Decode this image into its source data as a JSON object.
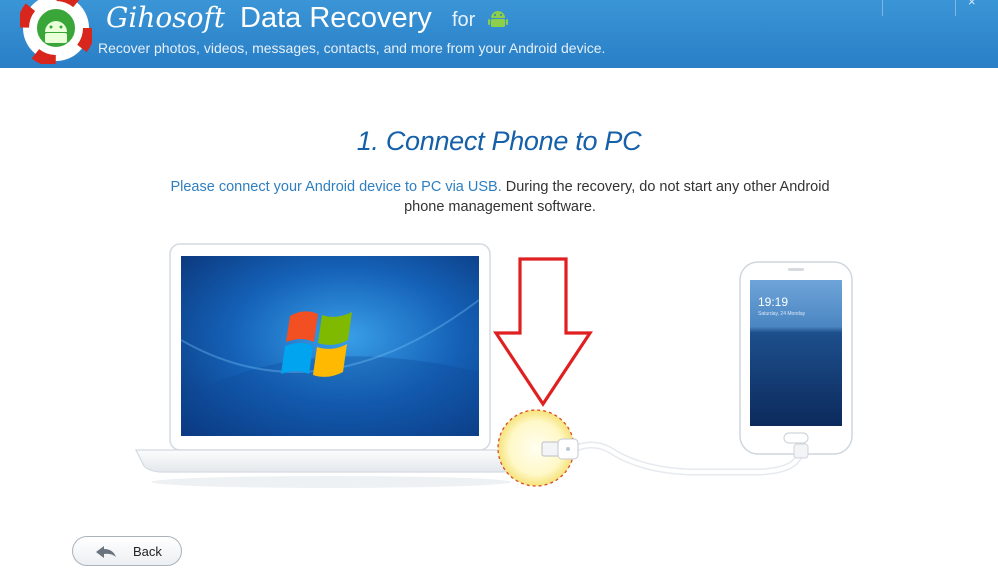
{
  "header": {
    "app_name_brand": "Gihosoft",
    "app_name_product": "Data Recovery",
    "app_name_for": "for",
    "tagline": "Recover photos, videos, messages, contacts, and more from your Android device.",
    "logo_icon": "lifebuoy-android-icon",
    "platform_icon": "android-icon",
    "close_glyph": "×"
  },
  "main": {
    "step_title": "1. Connect Phone to PC",
    "instruction_highlight": "Please connect your Android device to PC via USB.",
    "instruction_rest": " During the recovery, do not start any other Android phone management software.",
    "phone_time": "19:19",
    "phone_date": "Saturday, 24 Monday"
  },
  "footer": {
    "back_label": "Back",
    "back_icon": "back-arrow-icon"
  },
  "colors": {
    "header": "#2a82c8",
    "title": "#1560a8",
    "link": "#2e7fc1",
    "arrow": "#e02020"
  }
}
